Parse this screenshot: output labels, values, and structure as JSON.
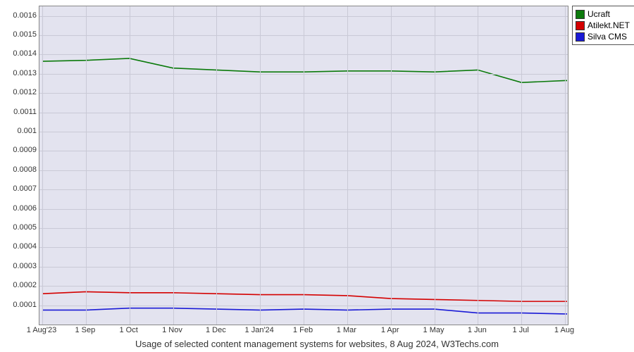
{
  "chart_data": {
    "type": "line",
    "title": "Usage of selected content management systems for websites, 8 Aug 2024, W3Techs.com",
    "xlabel": "",
    "ylabel": "",
    "ylim": [
      0,
      0.00165
    ],
    "y_ticks": [
      "0.0001",
      "0.0002",
      "0.0003",
      "0.0004",
      "0.0005",
      "0.0006",
      "0.0007",
      "0.0008",
      "0.0009",
      "0.001",
      "0.0011",
      "0.0012",
      "0.0013",
      "0.0014",
      "0.0015",
      "0.0016"
    ],
    "categories": [
      "1 Aug'23",
      "1 Sep",
      "1 Oct",
      "1 Nov",
      "1 Dec",
      "1 Jan'24",
      "1 Feb",
      "1 Mar",
      "1 Apr",
      "1 May",
      "1 Jun",
      "1 Jul",
      "1 Aug"
    ],
    "series": [
      {
        "name": "Ucraft",
        "color": "#0b7a0b",
        "values": [
          0.001365,
          0.00137,
          0.00138,
          0.00133,
          0.00132,
          0.00131,
          0.00131,
          0.001315,
          0.001315,
          0.00131,
          0.00132,
          0.001255,
          0.001265
        ]
      },
      {
        "name": "Atilekt.NET",
        "color": "#d40000",
        "values": [
          0.00016,
          0.00017,
          0.000165,
          0.000165,
          0.00016,
          0.000155,
          0.000155,
          0.00015,
          0.000135,
          0.00013,
          0.000125,
          0.00012,
          0.00012
        ]
      },
      {
        "name": "Silva CMS",
        "color": "#1a1ad6",
        "values": [
          7.5e-05,
          7.5e-05,
          8.5e-05,
          8.5e-05,
          8e-05,
          7.5e-05,
          8e-05,
          7.5e-05,
          8e-05,
          8e-05,
          6e-05,
          6e-05,
          5.5e-05
        ]
      }
    ]
  }
}
